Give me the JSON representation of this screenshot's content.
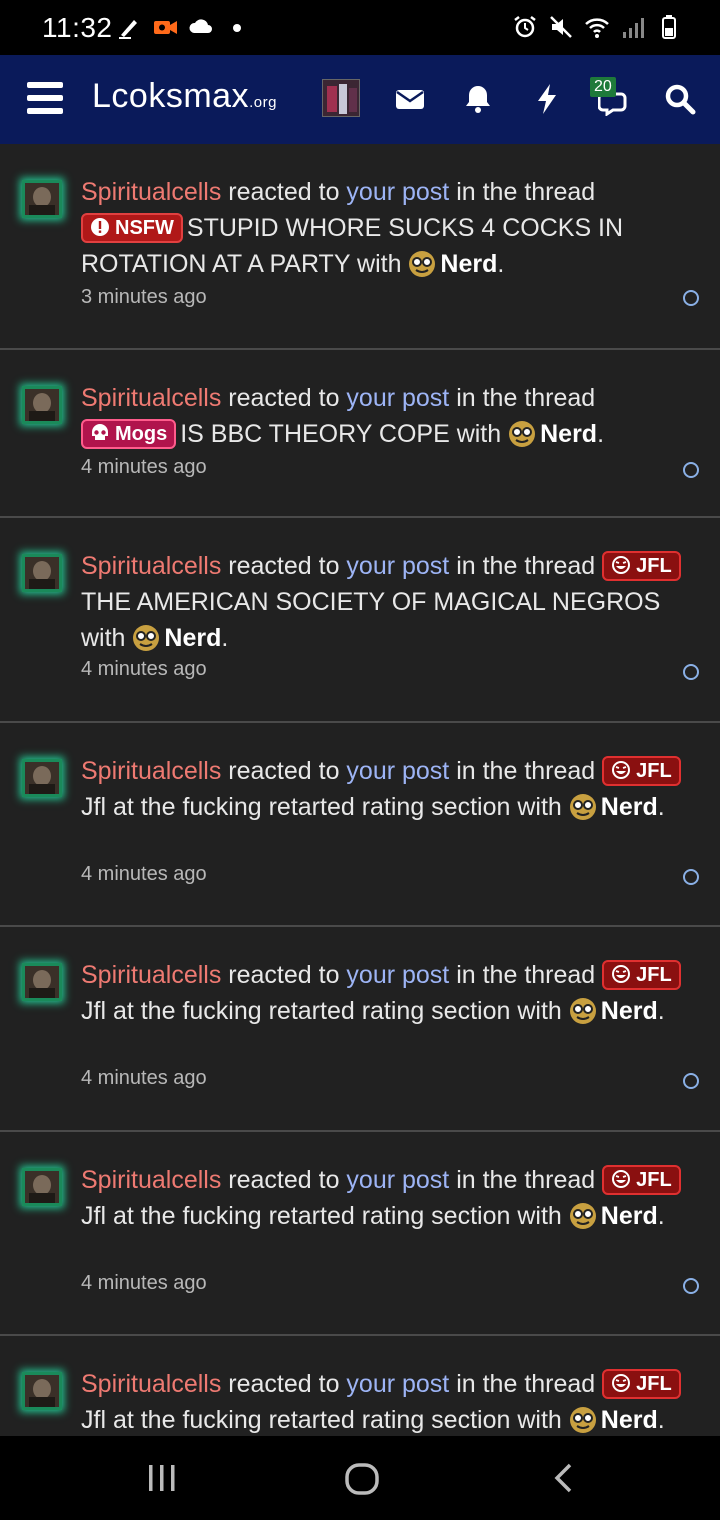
{
  "status_bar": {
    "time": "11:32"
  },
  "header": {
    "logo_main": "Lcoksmax",
    "logo_suffix": ".org",
    "messages_badge": "20"
  },
  "notifications": [
    {
      "user": "Spiritualcells",
      "action": " reacted to ",
      "link": "your post",
      "context": " in the thread ",
      "prefix": "NSFW",
      "prefix_style": "red",
      "prefix_icon": "alert-icon",
      "title": "STUPID WHORE SUCKS 4 COCKS IN ROTATION AT A PARTY",
      "with": " with ",
      "reaction": "Nerd",
      "time": "3 minutes ago"
    },
    {
      "user": "Spiritualcells",
      "action": " reacted to ",
      "link": "your post",
      "context": " in the thread ",
      "prefix": "Mogs",
      "prefix_style": "mogs",
      "prefix_icon": "skull-icon",
      "title": "IS BBC THEORY COPE",
      "with": " with ",
      "reaction": "Nerd",
      "time": "4 minutes ago"
    },
    {
      "user": "Spiritualcells",
      "action": " reacted to ",
      "link": "your post",
      "context": " in the thread ",
      "prefix": "JFL",
      "prefix_style": "jfl",
      "prefix_icon": "laugh-icon",
      "title": "THE AMERICAN SOCIETY OF MAGICAL NEGROS",
      "with": " with ",
      "reaction": "Nerd",
      "time": "4 minutes ago"
    },
    {
      "user": "Spiritualcells",
      "action": " reacted to ",
      "link": "your post",
      "context": " in the thread ",
      "prefix": "JFL",
      "prefix_style": "jfl",
      "prefix_icon": "laugh-icon",
      "title": "Jfl at the fucking retarted rating section",
      "with": " with ",
      "reaction": "Nerd",
      "time": "4 minutes ago"
    },
    {
      "user": "Spiritualcells",
      "action": " reacted to ",
      "link": "your post",
      "context": " in the thread ",
      "prefix": "JFL",
      "prefix_style": "jfl",
      "prefix_icon": "laugh-icon",
      "title": "Jfl at the fucking retarted rating section",
      "with": " with ",
      "reaction": "Nerd",
      "time": "4 minutes ago"
    },
    {
      "user": "Spiritualcells",
      "action": " reacted to ",
      "link": "your post",
      "context": " in the thread ",
      "prefix": "JFL",
      "prefix_style": "jfl",
      "prefix_icon": "laugh-icon",
      "title": "Jfl at the fucking retarted rating section",
      "with": " with ",
      "reaction": "Nerd",
      "time": "4 minutes ago"
    },
    {
      "user": "Spiritualcells",
      "action": " reacted to ",
      "link": "your post",
      "context": " in the thread ",
      "prefix": "JFL",
      "prefix_style": "jfl",
      "prefix_icon": "laugh-icon",
      "title": "Jfl at the fucking retarted rating section",
      "with": " with ",
      "reaction": "Nerd",
      "time": ""
    }
  ],
  "colors": {
    "header_bg": "#0a1a5a",
    "username": "#ee7a72",
    "link": "#9db4f5",
    "avatar_glow": "#23c995",
    "list_bg": "#212121"
  }
}
